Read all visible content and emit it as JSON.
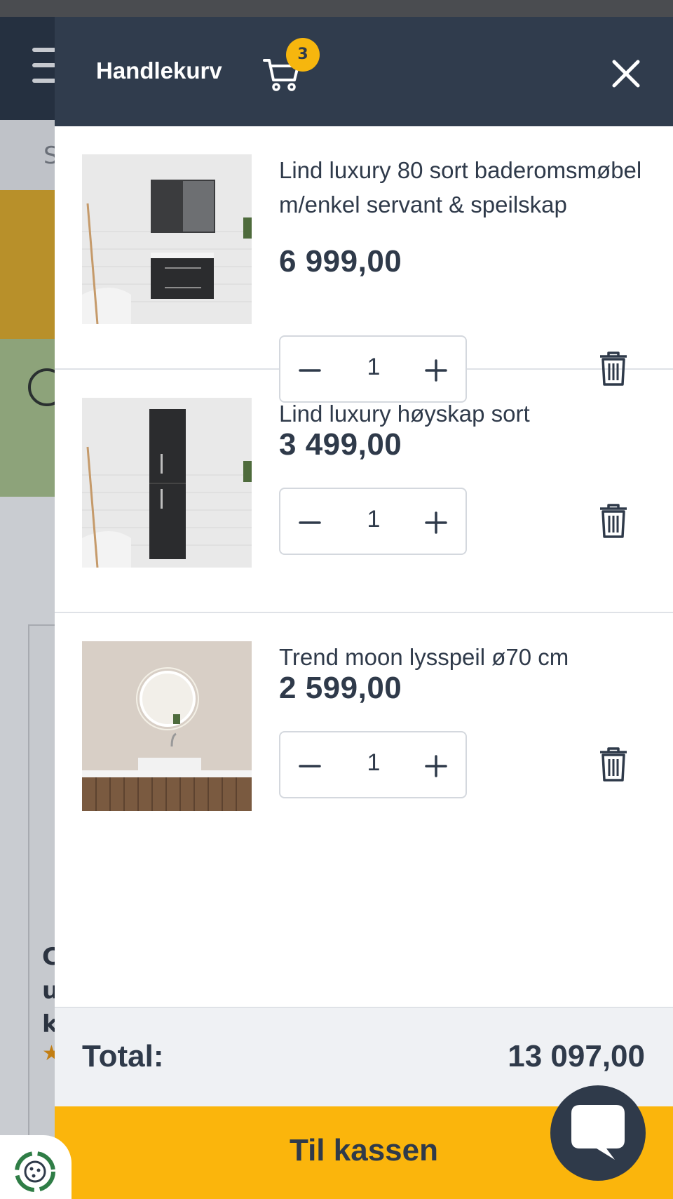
{
  "drawer": {
    "title": "Handlekurv",
    "cart_count": "3"
  },
  "items": [
    {
      "name": "Lind luxury 80 sort baderomsmøbel m/enkel servant & speilskap",
      "price": "6 999,00",
      "quantity": "1"
    },
    {
      "name": "Lind luxury høyskap sort",
      "price": "3 499,00",
      "quantity": "1"
    },
    {
      "name": "Trend moon lysspeil ø70 cm",
      "price": "2 599,00",
      "quantity": "1"
    }
  ],
  "summary": {
    "total_label": "Total:",
    "total_value": "13 097,00"
  },
  "checkout": {
    "label": "Til kassen"
  },
  "colors": {
    "header_bg": "#303c4d",
    "accent_yellow": "#fbb50c",
    "badge": "#f6b60e",
    "text": "#2f3a4a"
  },
  "background_page": {
    "search_fragment": "S",
    "card_text_fragment": "C u k"
  }
}
